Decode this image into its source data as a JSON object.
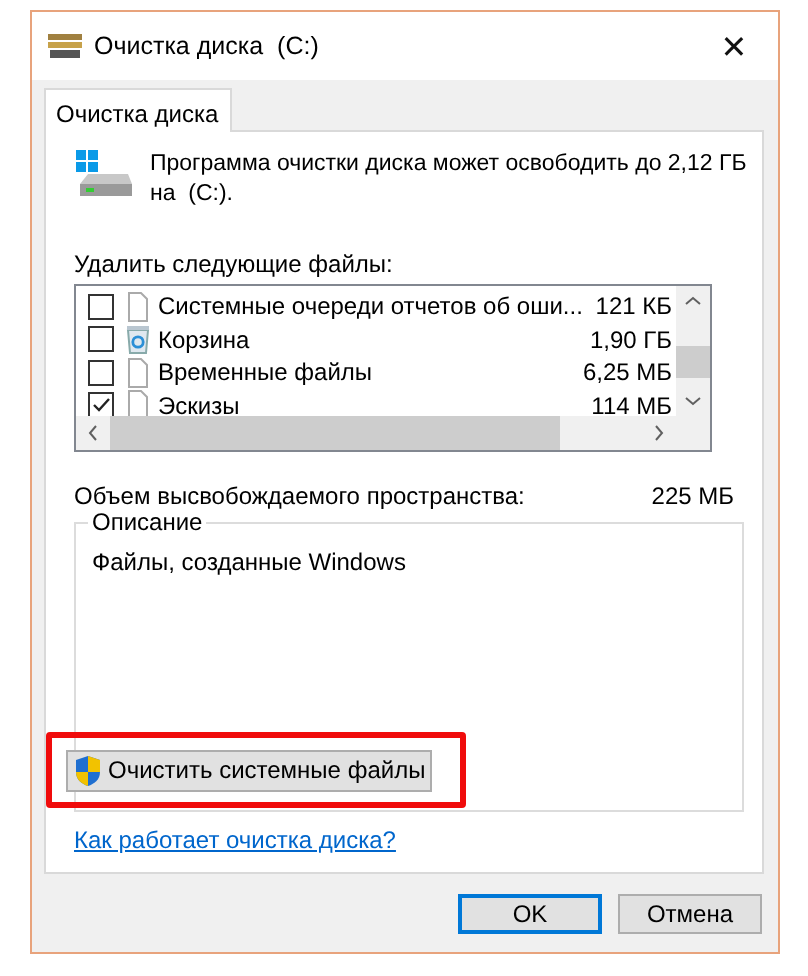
{
  "window": {
    "title": "Очистка диска  (C:)",
    "close": "✕"
  },
  "tabs": [
    {
      "label": "Очистка диска",
      "selected": true
    }
  ],
  "intro": "Программа очистки диска может освободить до 2,12 ГБ на  (C:).",
  "files_label": "Удалить следующие файлы:",
  "files": [
    {
      "kind": "file",
      "name": "Системные очереди отчетов об оши...",
      "size": "121 КБ",
      "checked": false
    },
    {
      "kind": "recycle",
      "name": "Корзина",
      "size": "1,90 ГБ",
      "checked": false
    },
    {
      "kind": "file",
      "name": "Временные файлы",
      "size": "6,25 МБ",
      "checked": false
    },
    {
      "kind": "file",
      "name": "Эскизы",
      "size": "114 МБ",
      "checked": true
    }
  ],
  "space": {
    "label": "Объем высвобождаемого пространства:",
    "value": "225 МБ"
  },
  "description": {
    "title": "Описание",
    "text": "Файлы, созданные Windows"
  },
  "cleanup_button": {
    "label": "Очистить системные файлы",
    "highlighted": true
  },
  "help_link": "Как работает очистка диска?",
  "buttons": [
    {
      "label": "OK",
      "default": true
    },
    {
      "label": "Отмена",
      "default": false
    }
  ]
}
